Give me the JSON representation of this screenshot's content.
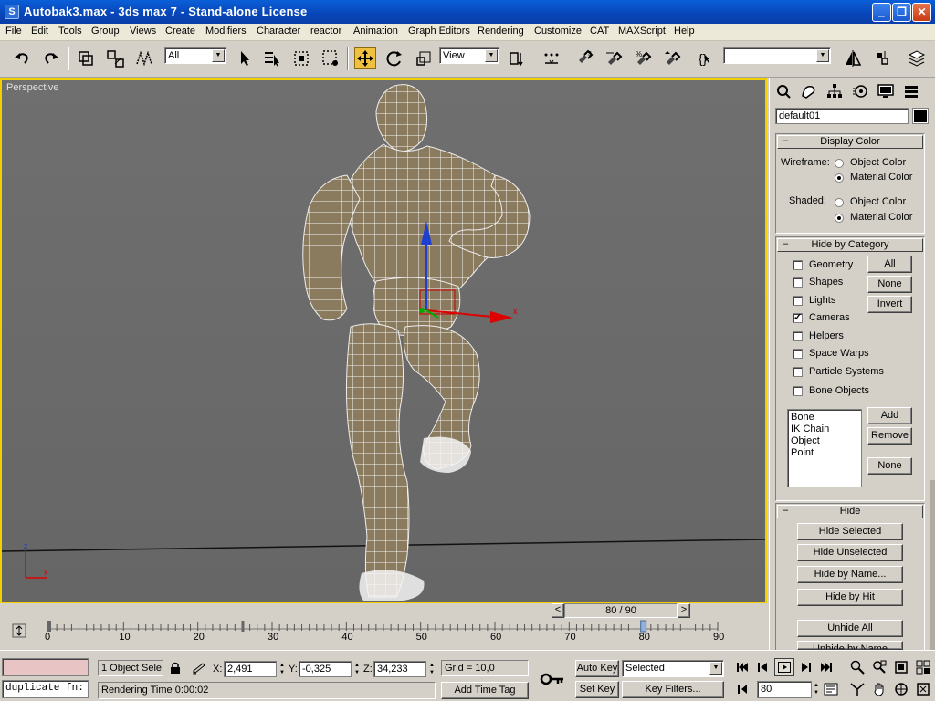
{
  "window": {
    "title": "Autobak3.max - 3ds max 7  - Stand-alone License"
  },
  "menu": [
    "File",
    "Edit",
    "Tools",
    "Group",
    "Views",
    "Create",
    "Modifiers",
    "Character",
    "reactor",
    "Animation",
    "Graph Editors",
    "Rendering",
    "Customize",
    "CAT",
    "MAXScript",
    "Help"
  ],
  "toolbar": {
    "selection_filter": "All",
    "reference_coord": "View",
    "named_selection": ""
  },
  "viewport": {
    "label": "Perspective",
    "axis_x": "x",
    "axis_z": "z",
    "gizmo_x_label": "x"
  },
  "command_panel": {
    "object_name": "default01",
    "object_color": "#000000",
    "display_color": {
      "title": "Display Color",
      "wireframe_label": "Wireframe:",
      "shaded_label": "Shaded:",
      "option_object": "Object Color",
      "option_material": "Material Color",
      "wireframe_value": "Material Color",
      "shaded_value": "Material Color"
    },
    "hide_by_category": {
      "title": "Hide by Category",
      "categories": [
        {
          "label": "Geometry",
          "checked": false
        },
        {
          "label": "Shapes",
          "checked": false
        },
        {
          "label": "Lights",
          "checked": false
        },
        {
          "label": "Cameras",
          "checked": true
        },
        {
          "label": "Helpers",
          "checked": false
        },
        {
          "label": "Space Warps",
          "checked": false
        },
        {
          "label": "Particle Systems",
          "checked": false
        },
        {
          "label": "Bone Objects",
          "checked": false
        }
      ],
      "btn_all": "All",
      "btn_none": "None",
      "btn_invert": "Invert",
      "list_items": [
        "Bone",
        "IK Chain Object",
        "Point"
      ],
      "btn_add": "Add",
      "btn_remove": "Remove",
      "btn_none2": "None"
    },
    "hide": {
      "title": "Hide",
      "hide_selected": "Hide Selected",
      "hide_unselected": "Hide Unselected",
      "hide_by_name": "Hide by Name...",
      "hide_by_hit": "Hide by Hit",
      "unhide_all": "Unhide All",
      "unhide_by_name": "Unhide by Name"
    }
  },
  "time_slider": {
    "frame_display": "80 / 90",
    "current_frame": 80,
    "total_frames": 90
  },
  "trackbar": {
    "ticks": [
      "0",
      "10",
      "20",
      "30",
      "40",
      "50",
      "60",
      "70",
      "80",
      "90"
    ]
  },
  "status": {
    "maxscript_output": "",
    "maxscript_input": "duplicate fn:",
    "selection_info": "1 Object Sele",
    "coord_x_label": "X:",
    "coord_x": "2,491",
    "coord_y_label": "Y:",
    "coord_y": "-0,325",
    "coord_z_label": "Z:",
    "coord_z": "34,233",
    "grid": "Grid = 10,0",
    "auto_key": "Auto Key",
    "set_key": "Set Key",
    "key_mode": "Selected",
    "key_filters": "Key Filters...",
    "frame_field": "80",
    "prompt": "Rendering Time  0:00:02",
    "add_time_tag": "Add Time Tag"
  }
}
